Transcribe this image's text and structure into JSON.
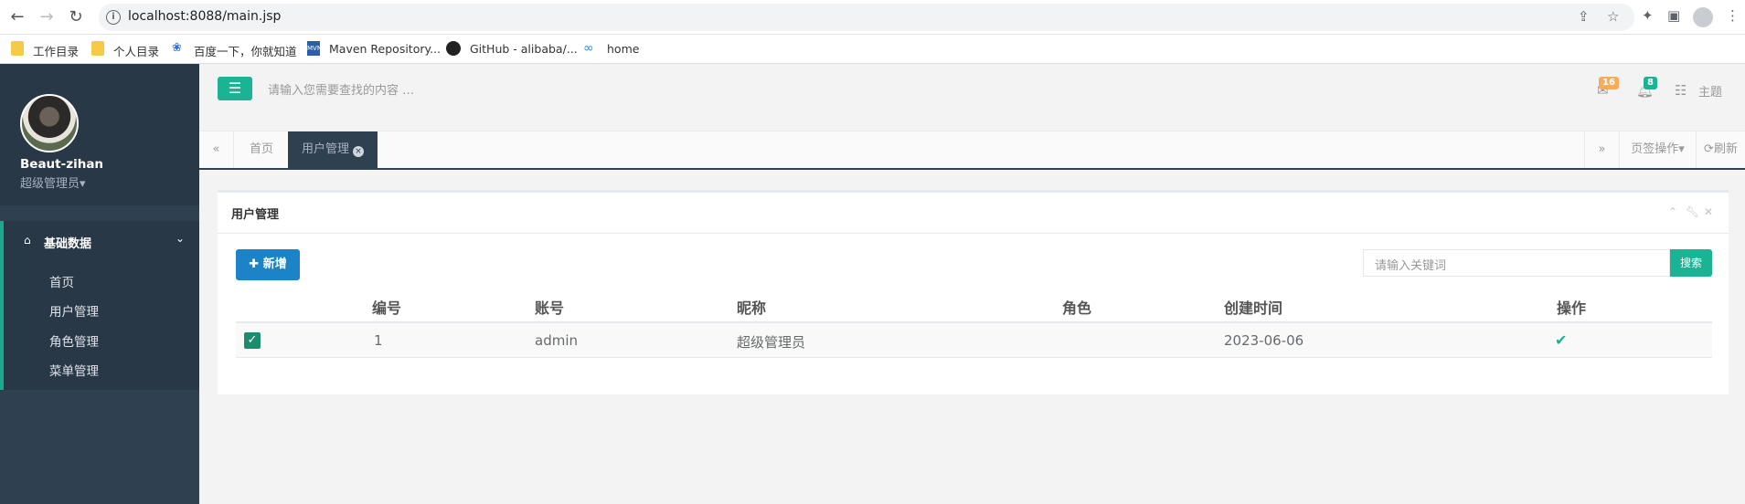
{
  "browser": {
    "url": "localhost:8088/main.jsp",
    "bookmarks": [
      "工作目录",
      "个人目录",
      "百度一下，你就知道",
      "Maven Repository...",
      "GitHub - alibaba/...",
      "home"
    ]
  },
  "sidebar": {
    "user_name": "Beaut-zihan",
    "user_role": "超级管理员▾",
    "group_label": "基础数据",
    "items": [
      {
        "label": "首页"
      },
      {
        "label": "用户管理"
      },
      {
        "label": "角色管理"
      },
      {
        "label": "菜单管理"
      }
    ]
  },
  "topbar": {
    "search_placeholder": "请输入您需要查找的内容 …",
    "mail_count": "16",
    "bell_count": "8",
    "theme_label": "主题"
  },
  "tabs": {
    "items": [
      {
        "label": "首页",
        "active": false
      },
      {
        "label": "用户管理",
        "active": true
      }
    ],
    "page_ops": "页签操作▾",
    "refresh": "刷新"
  },
  "panel": {
    "title": "用户管理",
    "new_button": "新增",
    "keyword_placeholder": "请输入关键词",
    "search_button": "搜索"
  },
  "table": {
    "headers": [
      "编号",
      "账号",
      "昵称",
      "角色",
      "创建时间",
      "操作"
    ],
    "rows": [
      {
        "id": "1",
        "account": "admin",
        "nickname": "超级管理员",
        "role": "",
        "created": "2023-06-06",
        "checked": true
      }
    ]
  },
  "colors": {
    "sidebar_bg": "#2f4050",
    "accent_green": "#1ab394",
    "primary_blue": "#1c84c6",
    "mail_badge": "#f8ac59",
    "bell_badge": "#1ab394"
  }
}
